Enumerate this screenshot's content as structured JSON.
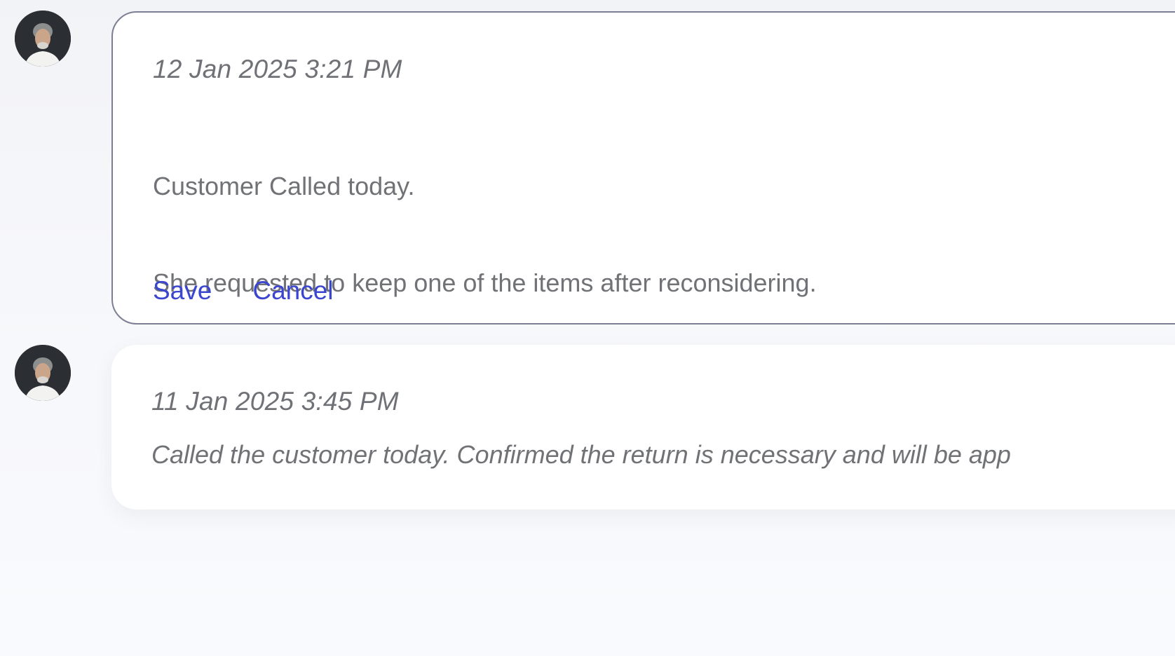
{
  "notes": [
    {
      "timestamp": "12 Jan 2025 3:21 PM",
      "text_line_1": "Customer Called today.",
      "text_line_2": "She requested to keep one of the items after reconsidering.",
      "save_label": "Save",
      "cancel_label": "Cancel",
      "mode": "editing",
      "avatar_icon": "user-avatar"
    },
    {
      "timestamp": "11 Jan 2025 3:45 PM",
      "text": "Called the customer today. Confirmed the return is necessary and will be app",
      "mode": "view",
      "avatar_icon": "user-avatar"
    }
  ],
  "colors": {
    "link": "#3a46d0",
    "text": "#707276",
    "editing_border": "#7c7e93"
  }
}
